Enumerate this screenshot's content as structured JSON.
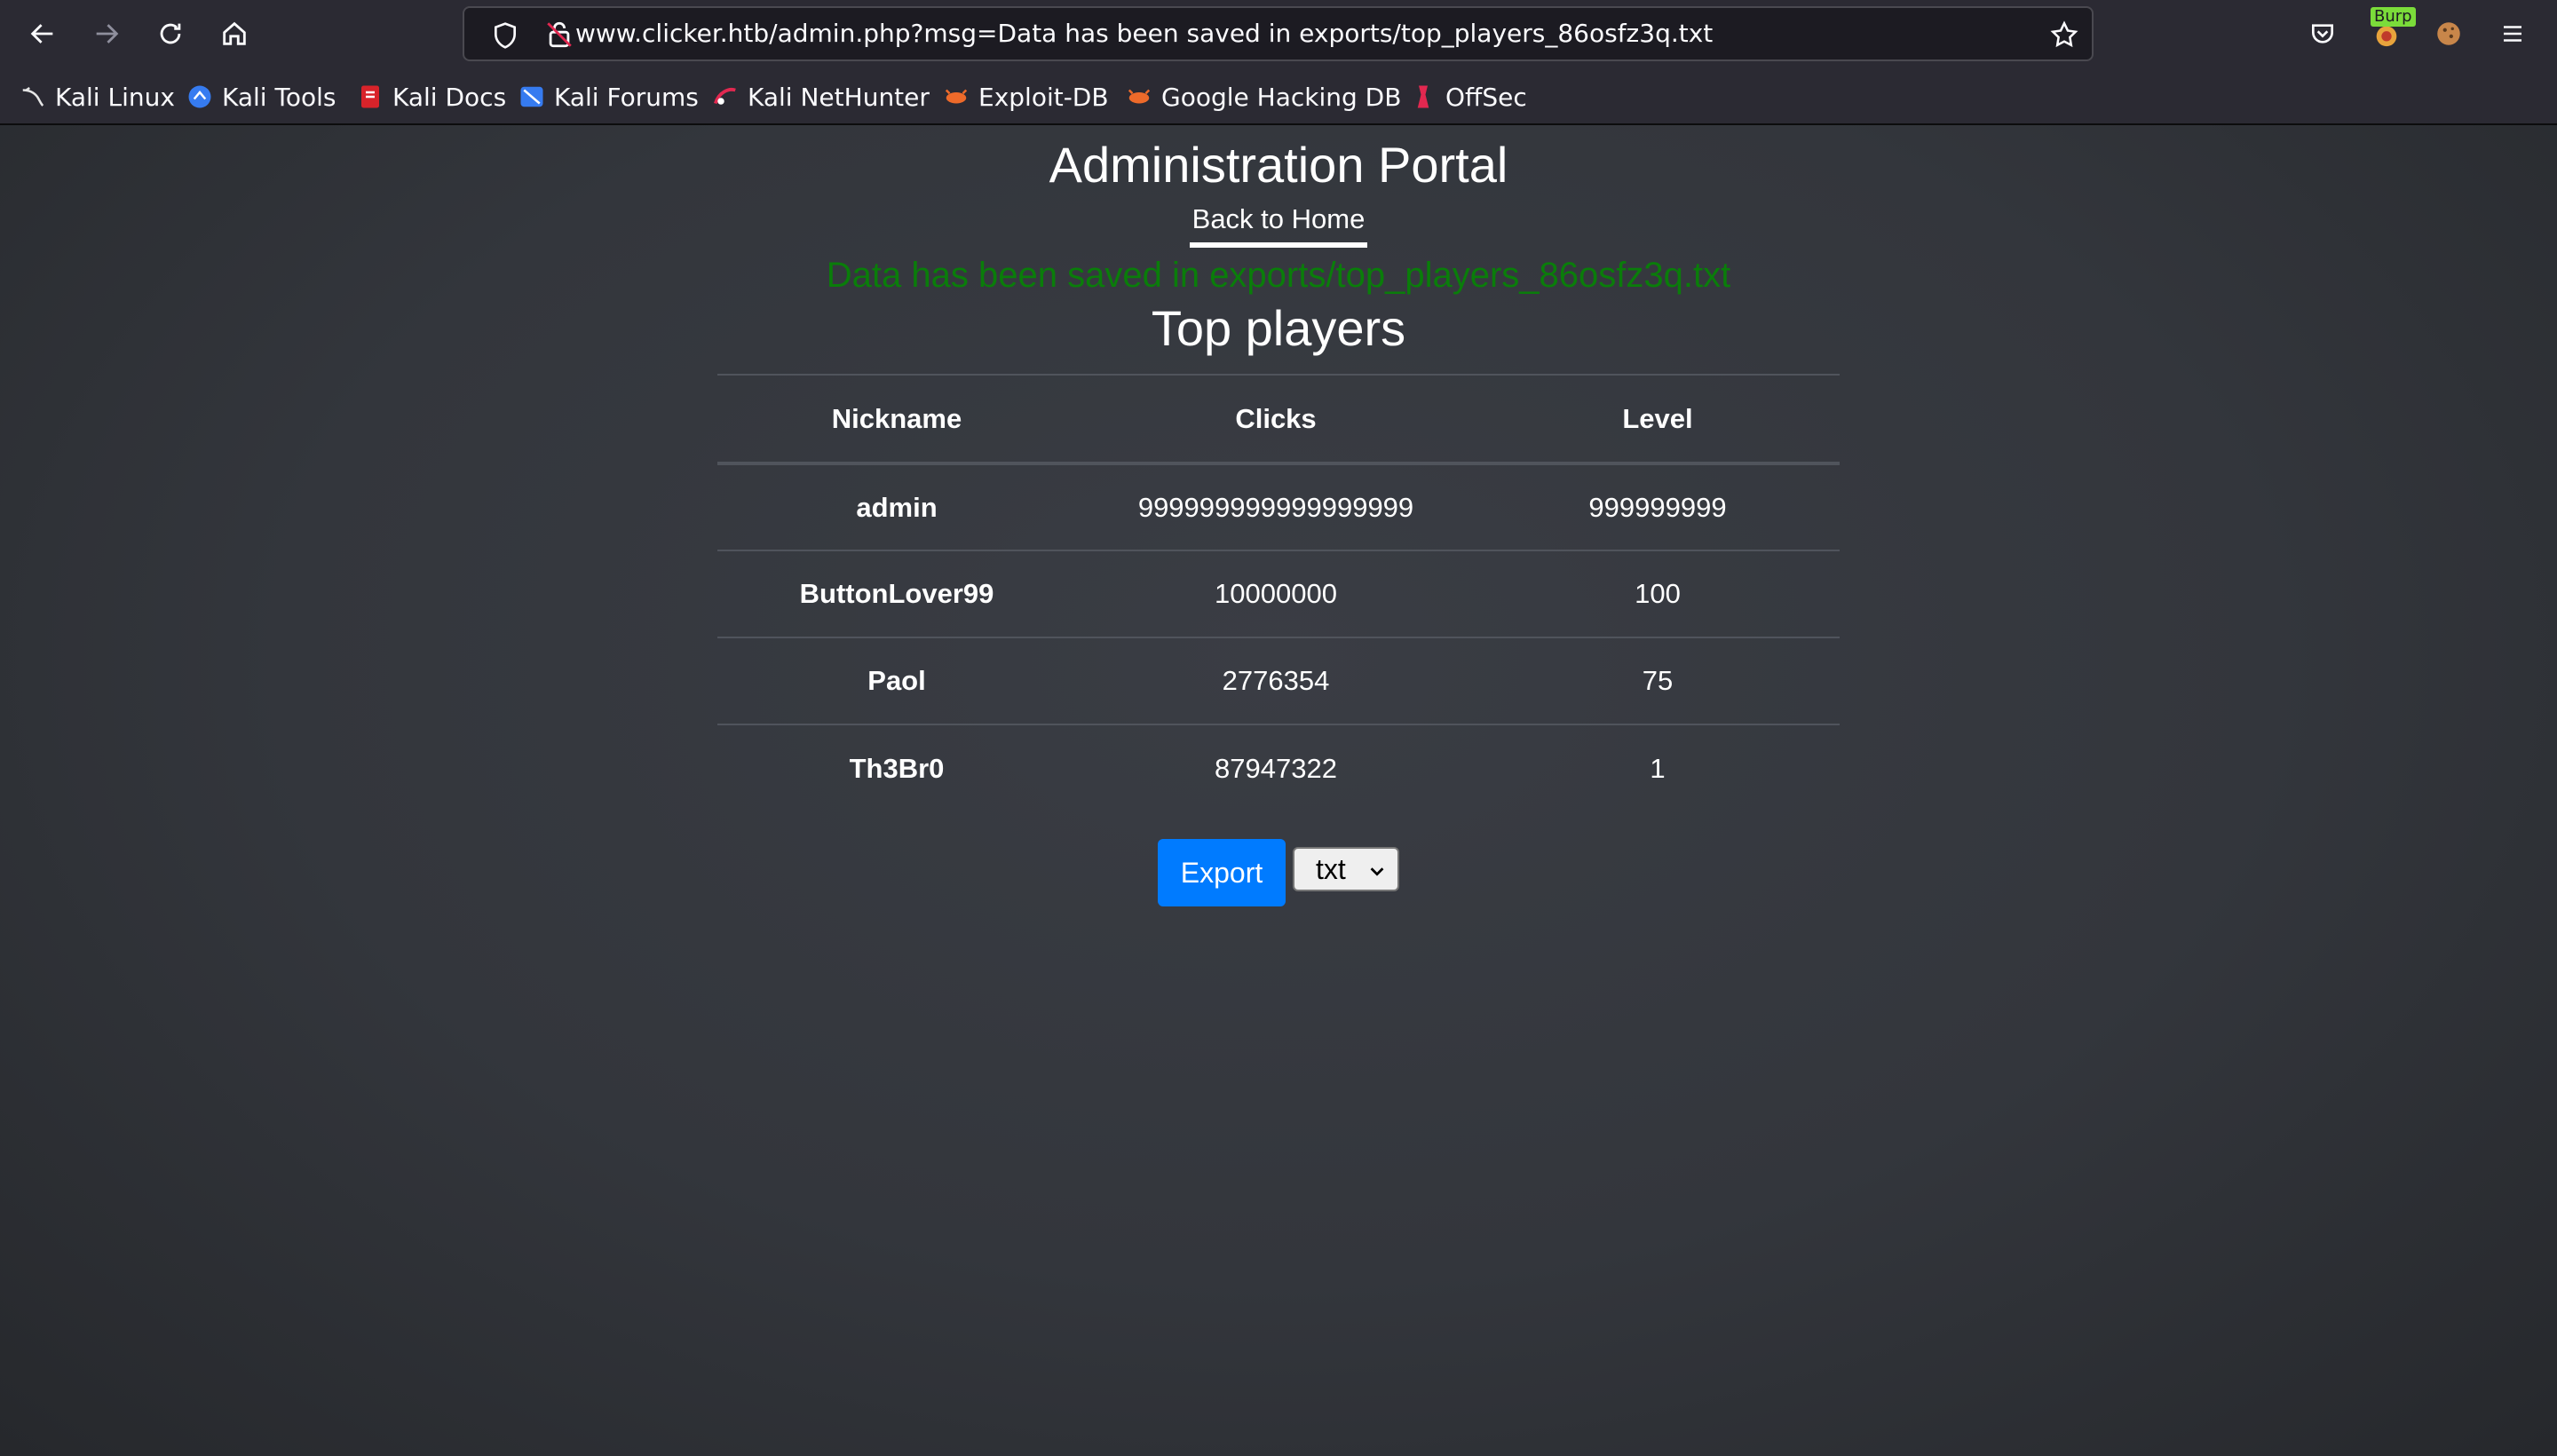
{
  "browser": {
    "url": "www.clicker.htb/admin.php?msg=Data has been saved in exports/top_players_86osfz3q.txt",
    "extension_badge": "Burp",
    "bookmarks": [
      {
        "label": "Kali Linux",
        "icon": "kali-dragon-icon"
      },
      {
        "label": "Kali Tools",
        "icon": "kali-tools-icon"
      },
      {
        "label": "Kali Docs",
        "icon": "kali-docs-icon"
      },
      {
        "label": "Kali Forums",
        "icon": "kali-forums-icon"
      },
      {
        "label": "Kali NetHunter",
        "icon": "nethunter-icon"
      },
      {
        "label": "Exploit-DB",
        "icon": "exploit-db-icon"
      },
      {
        "label": "Google Hacking DB",
        "icon": "ghdb-icon"
      },
      {
        "label": "OffSec",
        "icon": "offsec-icon"
      }
    ]
  },
  "page": {
    "title": "Administration Portal",
    "back_link": "Back to Home",
    "message": "Data has been saved in exports/top_players_86osfz3q.txt",
    "section_title": "Top players",
    "table": {
      "headers": [
        "Nickname",
        "Clicks",
        "Level"
      ],
      "rows": [
        {
          "nickname": "admin",
          "clicks": "999999999999999999",
          "level": "999999999"
        },
        {
          "nickname": "ButtonLover99",
          "clicks": "10000000",
          "level": "100"
        },
        {
          "nickname": "Paol",
          "clicks": "2776354",
          "level": "75"
        },
        {
          "nickname": "Th3Br0",
          "clicks": "87947322",
          "level": "1"
        }
      ]
    },
    "export_label": "Export",
    "format_selected": "txt"
  },
  "colors": {
    "accent": "#007bff",
    "message": "#0a7d0a",
    "background": "#33363c"
  }
}
